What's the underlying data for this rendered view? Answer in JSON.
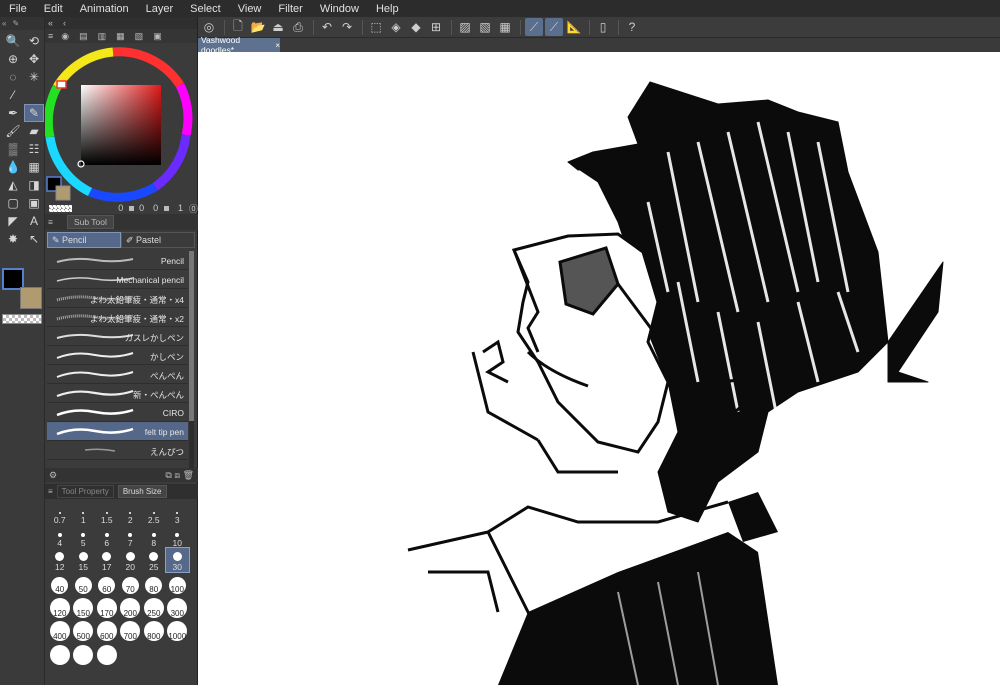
{
  "menu": [
    "File",
    "Edit",
    "Animation",
    "Layer",
    "Select",
    "View",
    "Filter",
    "Window",
    "Help"
  ],
  "document_tab": {
    "title": "Vashwood doodles*",
    "close": "×"
  },
  "color_panel": {
    "values": [
      "0",
      "0",
      "0",
      "0",
      "1"
    ],
    "main_color": "#000000",
    "sub_color": "#b09a70"
  },
  "subtool": {
    "header": "Sub Tool",
    "categories": [
      "Pencil",
      "Pastel"
    ],
    "active_category": "Pencil",
    "brushes": [
      {
        "name": "Pencil"
      },
      {
        "name": "Mechanical pencil"
      },
      {
        "name": "よわ太鉛筆疲・通常・x4"
      },
      {
        "name": "よわ太鉛筆疲・通常・x2"
      },
      {
        "name": "カスレかしペン"
      },
      {
        "name": "かしペン"
      },
      {
        "name": "ぺんぺん"
      },
      {
        "name": "新・ぺんぺん"
      },
      {
        "name": "CIRO"
      },
      {
        "name": "felt tip pen"
      },
      {
        "name": "えんぴつ"
      }
    ],
    "active_brush": "felt tip pen"
  },
  "brush_size": {
    "tabs": [
      "Tool Property",
      "Brush Size"
    ],
    "active_tab": "Brush Size",
    "sizes": [
      "0.7",
      "1",
      "1.5",
      "2",
      "2.5",
      "3",
      "4",
      "5",
      "6",
      "7",
      "8",
      "10",
      "12",
      "15",
      "17",
      "20",
      "25",
      "30",
      "40",
      "50",
      "60",
      "70",
      "80",
      "100",
      "120",
      "150",
      "170",
      "200",
      "250",
      "300",
      "400",
      "500",
      "600",
      "700",
      "800",
      "1000",
      "",
      "",
      ""
    ],
    "active_size": "30"
  },
  "toolbar_icons": [
    "zoom-icon",
    "move-icon",
    "object-icon",
    "lasso-icon",
    "magic-wand-icon",
    "eyedropper-icon",
    "pen-icon",
    "pencil-icon",
    "brush-icon",
    "eraser-icon",
    "airbrush-icon",
    "decoration-icon",
    "blend-icon",
    "fill-icon",
    "gradient-icon",
    "figure-icon",
    "frame-icon",
    "text-icon",
    "balloon-icon",
    "correct-line-icon"
  ]
}
